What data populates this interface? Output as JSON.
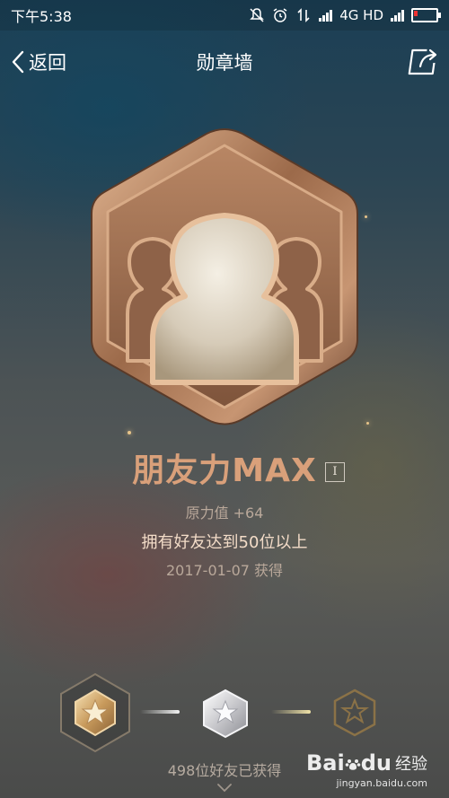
{
  "status_bar": {
    "time": "下午5:38",
    "network": "4G HD"
  },
  "nav": {
    "back_label": "返回",
    "title": "勋章墙"
  },
  "badge": {
    "name": "朋友力MAX",
    "level": "I",
    "power": "原力值 +64",
    "description": "拥有好友达到50位以上",
    "date": "2017-01-07 获得",
    "owned_count": "498位好友已获得"
  },
  "levels": [
    {
      "tier": "gold",
      "selected": true
    },
    {
      "tier": "silver",
      "selected": false
    },
    {
      "tier": "bronze-outline",
      "selected": false
    }
  ],
  "watermark": {
    "logo": "Bai",
    "logo_suffix": "du",
    "text": "经验",
    "url": "jingyan.baidu.com"
  },
  "colors": {
    "badge_name": "#d9a07a",
    "description": "#f3dcc8",
    "muted": "#b9a89a"
  }
}
